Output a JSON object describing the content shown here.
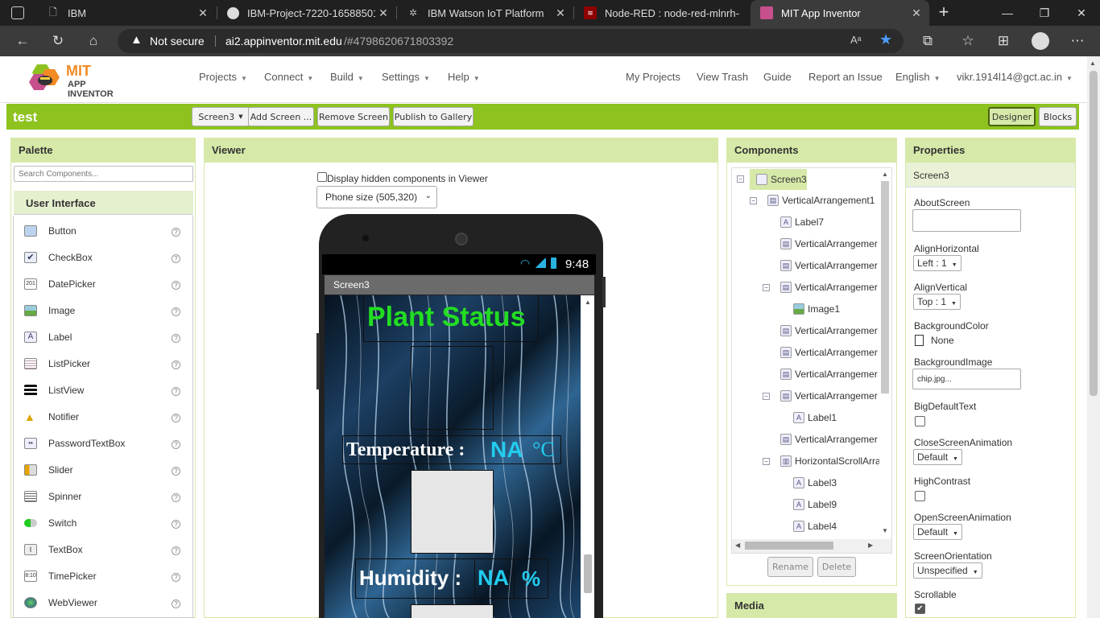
{
  "browser": {
    "tabs": [
      {
        "title": "IBM",
        "icon": "document-icon"
      },
      {
        "title": "IBM-Project-7220-16588501…",
        "icon": "github-icon"
      },
      {
        "title": "IBM Watson IoT Platform",
        "icon": "ibm-watson-icon"
      },
      {
        "title": "Node-RED : node-red-mlnrh-",
        "icon": "node-red-icon"
      },
      {
        "title": "MIT App Inventor",
        "icon": "app-inventor-icon"
      }
    ],
    "security_label": "Not secure",
    "url_host": "ai2.appinventor.mit.edu",
    "url_rest": "/#4798620671803392"
  },
  "app": {
    "logo_line1": "MIT",
    "logo_line2": "APP INVENTOR",
    "menus": [
      "Projects",
      "Connect",
      "Build",
      "Settings",
      "Help"
    ],
    "right_links": [
      "My Projects",
      "View Trash",
      "Guide",
      "Report an Issue"
    ],
    "language": "English",
    "user": "vikr.1914l14@gct.ac.in"
  },
  "toolbar": {
    "project_name": "test",
    "screen_select": "Screen3",
    "add_screen": "Add Screen ...",
    "remove_screen": "Remove Screen",
    "publish": "Publish to Gallery",
    "designer": "Designer",
    "blocks": "Blocks"
  },
  "palette": {
    "title": "Palette",
    "search_placeholder": "Search Components...",
    "category": "User Interface",
    "items": [
      "Button",
      "CheckBox",
      "DatePicker",
      "Image",
      "Label",
      "ListPicker",
      "ListView",
      "Notifier",
      "PasswordTextBox",
      "Slider",
      "Spinner",
      "Switch",
      "TextBox",
      "TimePicker",
      "WebViewer"
    ]
  },
  "viewer": {
    "title": "Viewer",
    "hidden_label": "Display hidden components in Viewer",
    "phone_size": "Phone size (505,320)",
    "status_time": "9:48",
    "screen_title": "Screen3",
    "heading": "Plant Status",
    "temp_label": "Temperature :",
    "temp_value": "NA",
    "temp_unit": "°C",
    "hum_label": "Humidity :",
    "hum_value": "NA",
    "hum_unit": "%"
  },
  "components": {
    "title": "Components",
    "tree": [
      "Screen3",
      "VerticalArrangement1",
      "Label7",
      "VerticalArrangemer",
      "VerticalArrangemer",
      "VerticalArrangemer",
      "Image1",
      "VerticalArrangemer",
      "VerticalArrangemer",
      "VerticalArrangemer",
      "VerticalArrangemer",
      "Label1",
      "VerticalArrangemer",
      "HorizontalScrollArra",
      "Label3",
      "Label9",
      "Label4"
    ],
    "rename": "Rename",
    "delete": "Delete",
    "media_title": "Media"
  },
  "properties": {
    "title": "Properties",
    "component": "Screen3",
    "labels": [
      "AboutScreen",
      "AlignHorizontal",
      "AlignVertical",
      "BackgroundColor",
      "BackgroundImage",
      "BigDefaultText",
      "CloseScreenAnimation",
      "HighContrast",
      "OpenScreenAnimation",
      "ScreenOrientation",
      "Scrollable"
    ],
    "align_horizontal": "Left : 1",
    "align_vertical": "Top : 1",
    "background_color": "None",
    "background_image": "chip.jpg...",
    "close_anim": "Default",
    "open_anim": "Default",
    "orientation": "Unspecified"
  },
  "colors": {
    "accent_green": "#8dc21f",
    "panel_header": "#d6e9a8",
    "heading_green": "#22dd22",
    "value_cyan": "#22ccee"
  }
}
